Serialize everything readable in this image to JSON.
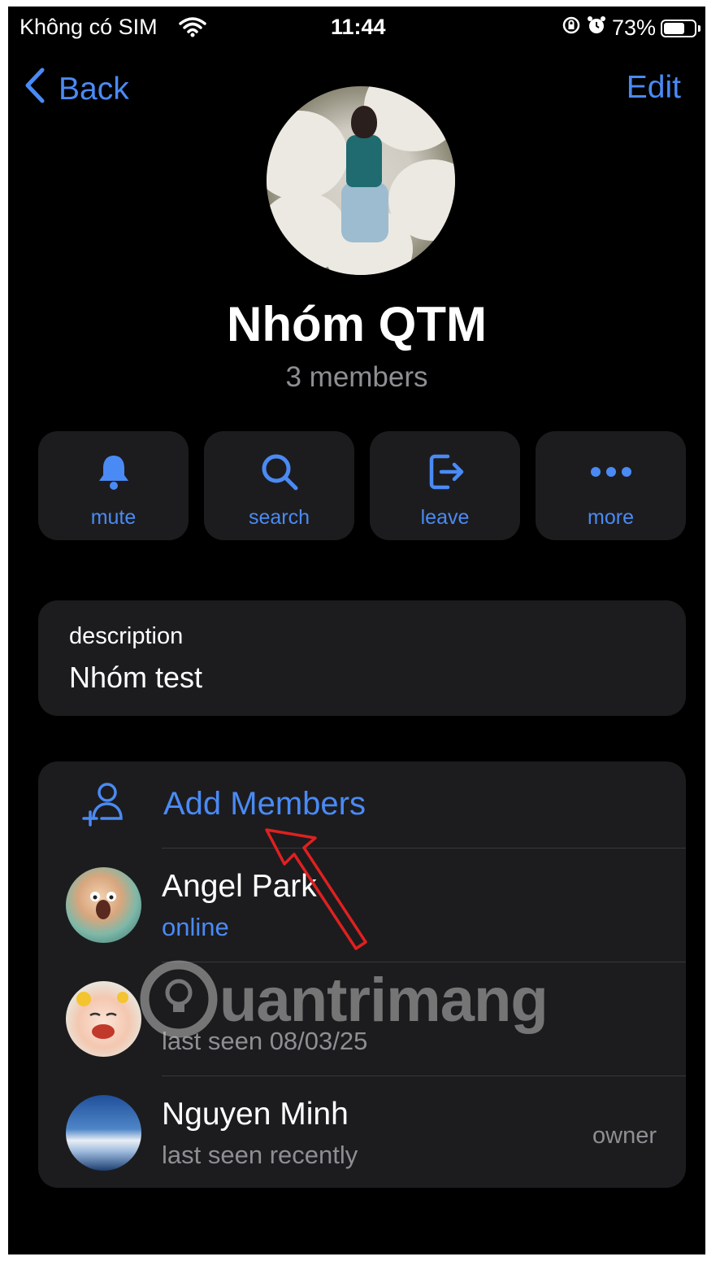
{
  "status_bar": {
    "carrier": "Không có SIM",
    "time": "11:44",
    "battery": "73%",
    "battery_level": 0.73,
    "icons": [
      "wifi-icon",
      "orientation-lock-icon",
      "alarm-icon",
      "battery-icon"
    ]
  },
  "nav": {
    "back_label": "Back",
    "edit_label": "Edit"
  },
  "group": {
    "name": "Nhóm QTM",
    "members_count": "3 members"
  },
  "actions": [
    {
      "label": "mute",
      "icon": "bell-icon"
    },
    {
      "label": "search",
      "icon": "search-icon"
    },
    {
      "label": "leave",
      "icon": "leave-icon"
    },
    {
      "label": "more",
      "icon": "more-icon"
    }
  ],
  "description": {
    "label": "description",
    "value": "Nhóm test"
  },
  "members_section": {
    "add_label": "Add Members",
    "add_icon": "add-member-icon",
    "members": [
      {
        "name": "Angel Park",
        "status": "online",
        "role": ""
      },
      {
        "name": "",
        "status": "last seen 08/03/25",
        "role": ""
      },
      {
        "name": "Nguyen Minh",
        "status": "last seen recently",
        "role": "owner"
      }
    ]
  },
  "watermark": {
    "text": "uantrimang"
  },
  "colors": {
    "accent": "#4a8af4",
    "background": "#000000",
    "card": "#1c1c1e",
    "secondary_text": "#8e8e93",
    "annotation_arrow": "#e02020"
  }
}
